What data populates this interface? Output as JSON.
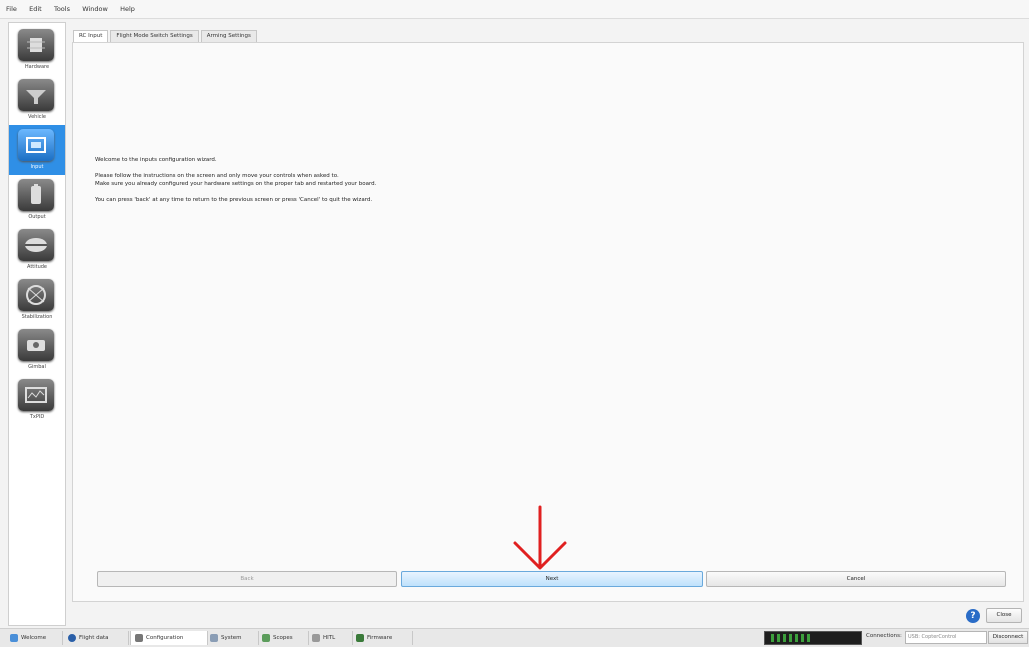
{
  "menu": [
    "File",
    "Edit",
    "Tools",
    "Window",
    "Help"
  ],
  "sidebar": {
    "items": [
      {
        "label": "Hardware",
        "icon": "chip-icon",
        "active": false
      },
      {
        "label": "Vehicle",
        "icon": "vehicle-icon",
        "active": false
      },
      {
        "label": "Input",
        "icon": "transmitter-icon",
        "active": true
      },
      {
        "label": "Output",
        "icon": "battery-output-icon",
        "active": false
      },
      {
        "label": "Attitude",
        "icon": "attitude-icon",
        "active": false
      },
      {
        "label": "Stabilization",
        "icon": "stabilization-icon",
        "active": false
      },
      {
        "label": "Gimbal",
        "icon": "gimbal-icon",
        "active": false
      },
      {
        "label": "TxPID",
        "icon": "txpid-icon",
        "active": false
      }
    ]
  },
  "tabs": [
    "RC Input",
    "Flight Mode Switch Settings",
    "Arming Settings"
  ],
  "wizard": {
    "welcome": "Welcome to the inputs configuration wizard.",
    "instructions1": "Please follow the instructions on the screen and only move your controls when asked to.",
    "instructions2": "Make sure you already configured your hardware settings on the proper tab and restarted your board.",
    "instructions3": "You can press 'back' at any time to return to the previous screen or press 'Cancel' to quit the wizard."
  },
  "buttons": {
    "back": "Back",
    "next": "Next",
    "cancel": "Cancel",
    "close": "Close"
  },
  "help_label": "?",
  "bottom_tabs": [
    "Welcome",
    "Flight data",
    "Configuration",
    "System",
    "Scopes",
    "HITL",
    "Firmware"
  ],
  "status": {
    "connections_label": "Connections:",
    "connection_select": "USB: CopterControl",
    "disconnect": "Disconnect"
  },
  "colors": {
    "accent": "#2f8fe6",
    "arrow": "#e02020",
    "primary_button": "#bfe1fb"
  }
}
